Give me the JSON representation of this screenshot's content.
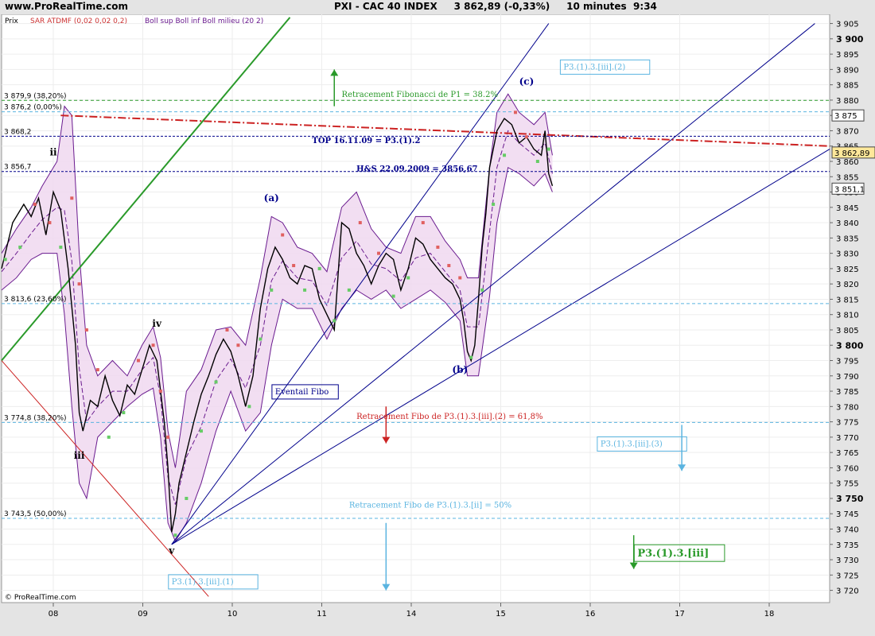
{
  "header": {
    "site": "www.ProRealTime.com",
    "title": "PXI - CAC 40 INDEX     3 862,89 (-0,33%)     10 minutes  9:34"
  },
  "legend": {
    "prix": "Prix",
    "sar": "SAR ATDMF (0,02 0,02 0,2)",
    "boll": "Boll sup Boll inf Boll milieu (20 2)"
  },
  "copyright": "© ProRealTime.com",
  "colors": {
    "price": "#000000",
    "sar_up": "#66cc66",
    "sar_down": "#e06060",
    "boll_fill": "#f0d8f0",
    "boll_line": "#6a1b8f",
    "fib_line": "#5ab4e0",
    "blue_line": "#00008b",
    "green_line": "#2a9a2a",
    "red_line": "#cc2222"
  },
  "chart_data": {
    "type": "line",
    "x_ticks": [
      "08",
      "09",
      "10",
      "11",
      "14",
      "15",
      "16",
      "17",
      "18"
    ],
    "y_ticks": [
      3720,
      3725,
      3730,
      3735,
      3740,
      3745,
      3750,
      3755,
      3760,
      3765,
      3770,
      3775,
      3780,
      3785,
      3790,
      3795,
      3800,
      3805,
      3810,
      3815,
      3820,
      3825,
      3830,
      3835,
      3840,
      3845,
      3850,
      3855,
      3860,
      3865,
      3870,
      3875,
      3880,
      3885,
      3890,
      3895,
      3900,
      3905
    ],
    "y_tick_labels": [
      "3 720",
      "3 725",
      "3 730",
      "3 735",
      "3 740",
      "3 745",
      "3 750",
      "3 755",
      "3 760",
      "3 765",
      "3 770",
      "3 775",
      "3 780",
      "3 785",
      "3 790",
      "3 795",
      "3 800",
      "3 805",
      "3 810",
      "3 815",
      "3 820",
      "3 825",
      "3 830",
      "3 835",
      "3 840",
      "3 845",
      "3 850",
      "3 855",
      "3 860",
      "3 865",
      "3 870",
      "3 875",
      "3 880",
      "3 885",
      "3 890",
      "3 895",
      "3 900",
      "3 905"
    ],
    "y_bold": [
      3750,
      3800,
      3900
    ],
    "ylim": [
      3716,
      3908
    ],
    "xlim": [
      7.5,
      18.7
    ],
    "price_path": [
      [
        7.5,
        3825
      ],
      [
        7.65,
        3840
      ],
      [
        7.8,
        3846
      ],
      [
        7.9,
        3842
      ],
      [
        8.0,
        3848
      ],
      [
        8.1,
        3836
      ],
      [
        8.2,
        3850
      ],
      [
        8.3,
        3844
      ],
      [
        8.4,
        3825
      ],
      [
        8.5,
        3800
      ],
      [
        8.55,
        3778
      ],
      [
        8.6,
        3772
      ],
      [
        8.7,
        3782
      ],
      [
        8.8,
        3780
      ],
      [
        8.9,
        3790
      ],
      [
        9.0,
        3782
      ],
      [
        9.1,
        3777
      ],
      [
        9.2,
        3787
      ],
      [
        9.3,
        3784
      ],
      [
        9.4,
        3792
      ],
      [
        9.5,
        3800
      ],
      [
        9.6,
        3795
      ],
      [
        9.7,
        3775
      ],
      [
        9.75,
        3760
      ],
      [
        9.8,
        3739
      ],
      [
        9.85,
        3745
      ],
      [
        9.9,
        3755
      ],
      [
        10.0,
        3765
      ],
      [
        10.1,
        3775
      ],
      [
        10.2,
        3784
      ],
      [
        10.3,
        3790
      ],
      [
        10.4,
        3797
      ],
      [
        10.5,
        3802
      ],
      [
        10.6,
        3798
      ],
      [
        10.7,
        3790
      ],
      [
        10.8,
        3780
      ],
      [
        10.9,
        3790
      ],
      [
        11.0,
        3812
      ],
      [
        11.1,
        3825
      ],
      [
        11.2,
        3832
      ],
      [
        11.3,
        3828
      ],
      [
        11.4,
        3822
      ],
      [
        11.5,
        3820
      ],
      [
        11.6,
        3826
      ],
      [
        11.7,
        3825
      ],
      [
        11.8,
        3815
      ],
      [
        11.9,
        3810
      ],
      [
        12.0,
        3805
      ],
      [
        12.1,
        3840
      ],
      [
        12.2,
        3838
      ],
      [
        12.3,
        3830
      ],
      [
        12.4,
        3826
      ],
      [
        12.5,
        3820
      ],
      [
        12.6,
        3826
      ],
      [
        12.7,
        3830
      ],
      [
        12.8,
        3828
      ],
      [
        12.9,
        3818
      ],
      [
        13.0,
        3825
      ],
      [
        13.1,
        3835
      ],
      [
        13.2,
        3833
      ],
      [
        13.3,
        3828
      ],
      [
        13.4,
        3825
      ],
      [
        13.5,
        3822
      ],
      [
        13.6,
        3820
      ],
      [
        13.7,
        3815
      ],
      [
        13.75,
        3808
      ],
      [
        13.8,
        3798
      ],
      [
        13.85,
        3795
      ],
      [
        13.9,
        3800
      ],
      [
        13.95,
        3815
      ],
      [
        14.0,
        3832
      ],
      [
        14.05,
        3843
      ],
      [
        14.1,
        3858
      ],
      [
        14.2,
        3870
      ],
      [
        14.3,
        3874
      ],
      [
        14.4,
        3872
      ],
      [
        14.5,
        3866
      ],
      [
        14.6,
        3868
      ],
      [
        14.7,
        3864
      ],
      [
        14.8,
        3862
      ],
      [
        14.85,
        3870
      ],
      [
        14.9,
        3856
      ],
      [
        14.95,
        3852
      ]
    ],
    "sar_path": [
      [
        7.55,
        3828,
        "up"
      ],
      [
        7.75,
        3832,
        "up"
      ],
      [
        7.95,
        3846,
        "down"
      ],
      [
        8.15,
        3840,
        "down"
      ],
      [
        8.3,
        3832,
        "up"
      ],
      [
        8.45,
        3848,
        "down"
      ],
      [
        8.55,
        3820,
        "down"
      ],
      [
        8.65,
        3805,
        "down"
      ],
      [
        8.8,
        3792,
        "down"
      ],
      [
        8.95,
        3770,
        "up"
      ],
      [
        9.15,
        3778,
        "up"
      ],
      [
        9.35,
        3795,
        "down"
      ],
      [
        9.55,
        3800,
        "down"
      ],
      [
        9.65,
        3785,
        "down"
      ],
      [
        9.75,
        3770,
        "down"
      ],
      [
        9.85,
        3738,
        "up"
      ],
      [
        10.0,
        3750,
        "up"
      ],
      [
        10.2,
        3772,
        "up"
      ],
      [
        10.4,
        3788,
        "up"
      ],
      [
        10.55,
        3805,
        "down"
      ],
      [
        10.7,
        3800,
        "down"
      ],
      [
        10.85,
        3780,
        "up"
      ],
      [
        11.0,
        3802,
        "up"
      ],
      [
        11.15,
        3818,
        "up"
      ],
      [
        11.3,
        3836,
        "down"
      ],
      [
        11.45,
        3826,
        "down"
      ],
      [
        11.6,
        3818,
        "up"
      ],
      [
        11.8,
        3825,
        "up"
      ],
      [
        12.0,
        3808,
        "up"
      ],
      [
        12.2,
        3818,
        "up"
      ],
      [
        12.35,
        3840,
        "down"
      ],
      [
        12.6,
        3830,
        "down"
      ],
      [
        12.8,
        3816,
        "up"
      ],
      [
        13.0,
        3822,
        "up"
      ],
      [
        13.2,
        3840,
        "down"
      ],
      [
        13.4,
        3832,
        "down"
      ],
      [
        13.55,
        3826,
        "down"
      ],
      [
        13.7,
        3822,
        "down"
      ],
      [
        13.85,
        3796,
        "up"
      ],
      [
        14.0,
        3818,
        "up"
      ],
      [
        14.15,
        3846,
        "up"
      ],
      [
        14.3,
        3862,
        "up"
      ],
      [
        14.45,
        3876,
        "down"
      ],
      [
        14.6,
        3868,
        "down"
      ],
      [
        14.75,
        3860,
        "up"
      ],
      [
        14.9,
        3864,
        "up"
      ]
    ],
    "boll_upper": [
      [
        7.5,
        3830
      ],
      [
        7.7,
        3838
      ],
      [
        7.9,
        3845
      ],
      [
        8.05,
        3852
      ],
      [
        8.25,
        3860
      ],
      [
        8.35,
        3878
      ],
      [
        8.45,
        3875
      ],
      [
        8.55,
        3830
      ],
      [
        8.65,
        3800
      ],
      [
        8.8,
        3790
      ],
      [
        9.0,
        3795
      ],
      [
        9.2,
        3790
      ],
      [
        9.4,
        3800
      ],
      [
        9.55,
        3806
      ],
      [
        9.65,
        3796
      ],
      [
        9.75,
        3772
      ],
      [
        9.85,
        3760
      ],
      [
        10.0,
        3785
      ],
      [
        10.2,
        3792
      ],
      [
        10.4,
        3805
      ],
      [
        10.6,
        3806
      ],
      [
        10.8,
        3800
      ],
      [
        11.0,
        3822
      ],
      [
        11.15,
        3842
      ],
      [
        11.3,
        3840
      ],
      [
        11.5,
        3832
      ],
      [
        11.7,
        3830
      ],
      [
        11.9,
        3824
      ],
      [
        12.1,
        3845
      ],
      [
        12.3,
        3850
      ],
      [
        12.5,
        3838
      ],
      [
        12.7,
        3832
      ],
      [
        12.9,
        3830
      ],
      [
        13.1,
        3842
      ],
      [
        13.3,
        3842
      ],
      [
        13.5,
        3834
      ],
      [
        13.7,
        3828
      ],
      [
        13.8,
        3822
      ],
      [
        13.95,
        3822
      ],
      [
        14.1,
        3858
      ],
      [
        14.2,
        3876
      ],
      [
        14.35,
        3882
      ],
      [
        14.5,
        3876
      ],
      [
        14.7,
        3872
      ],
      [
        14.85,
        3876
      ],
      [
        14.95,
        3862
      ]
    ],
    "boll_lower": [
      [
        7.5,
        3818
      ],
      [
        7.7,
        3822
      ],
      [
        7.9,
        3828
      ],
      [
        8.05,
        3830
      ],
      [
        8.25,
        3830
      ],
      [
        8.35,
        3810
      ],
      [
        8.45,
        3780
      ],
      [
        8.55,
        3755
      ],
      [
        8.65,
        3750
      ],
      [
        8.8,
        3770
      ],
      [
        9.0,
        3775
      ],
      [
        9.2,
        3780
      ],
      [
        9.4,
        3784
      ],
      [
        9.55,
        3786
      ],
      [
        9.65,
        3770
      ],
      [
        9.75,
        3742
      ],
      [
        9.85,
        3736
      ],
      [
        10.0,
        3742
      ],
      [
        10.2,
        3755
      ],
      [
        10.4,
        3772
      ],
      [
        10.6,
        3785
      ],
      [
        10.8,
        3772
      ],
      [
        11.0,
        3778
      ],
      [
        11.15,
        3800
      ],
      [
        11.3,
        3815
      ],
      [
        11.5,
        3812
      ],
      [
        11.7,
        3812
      ],
      [
        11.9,
        3802
      ],
      [
        12.1,
        3812
      ],
      [
        12.3,
        3818
      ],
      [
        12.5,
        3815
      ],
      [
        12.7,
        3818
      ],
      [
        12.9,
        3812
      ],
      [
        13.1,
        3815
      ],
      [
        13.3,
        3818
      ],
      [
        13.5,
        3814
      ],
      [
        13.7,
        3808
      ],
      [
        13.8,
        3790
      ],
      [
        13.95,
        3790
      ],
      [
        14.1,
        3816
      ],
      [
        14.2,
        3840
      ],
      [
        14.35,
        3858
      ],
      [
        14.5,
        3856
      ],
      [
        14.7,
        3852
      ],
      [
        14.85,
        3856
      ],
      [
        14.95,
        3850
      ]
    ],
    "hlines": [
      {
        "value": 3879.9,
        "label": "3 879,9 (38,20%)",
        "color": "#2a9a2a"
      },
      {
        "value": 3876.2,
        "label": "3 876,2 (0,00%)",
        "color": "#5ab4e0"
      },
      {
        "value": 3868.2,
        "label": "3 868,2",
        "color": "#00008b"
      },
      {
        "value": 3856.7,
        "label": "3 856,7",
        "color": "#00008b"
      },
      {
        "value": 3813.6,
        "label": "3 813,6 (23,60%)",
        "color": "#5ab4e0"
      },
      {
        "value": 3774.8,
        "label": "3 774,8 (38,20%)",
        "color": "#5ab4e0"
      },
      {
        "value": 3743.5,
        "label": "3 743,5 (50,00%)",
        "color": "#5ab4e0"
      }
    ],
    "price_tags": [
      {
        "value": 3875,
        "label": "3 875"
      },
      {
        "value": 3862.89,
        "label": "3 862,89"
      },
      {
        "value": 3851.1,
        "label": "3 851,1"
      }
    ],
    "wave_labels": [
      {
        "x": 8.2,
        "y": 3862,
        "label": "ii",
        "color": "#000000"
      },
      {
        "x": 8.55,
        "y": 3763,
        "label": "iii",
        "color": "#000000"
      },
      {
        "x": 9.6,
        "y": 3806,
        "label": "iv",
        "color": "#000000"
      },
      {
        "x": 9.8,
        "y": 3732,
        "label": "v",
        "color": "#000000"
      },
      {
        "x": 11.15,
        "y": 3847,
        "label": "(a)",
        "color": "#00008b"
      },
      {
        "x": 13.7,
        "y": 3791,
        "label": "(b)",
        "color": "#00008b"
      },
      {
        "x": 14.6,
        "y": 3885,
        "label": "(c)",
        "color": "#00008b"
      }
    ],
    "annotations": [
      {
        "x": 12.1,
        "y": 3881,
        "label": "Retracement Fibonacci de P1 = 38.2%",
        "color": "#2a9a2a",
        "box": false
      },
      {
        "x": 11.7,
        "y": 3866,
        "label": "TOP 16.11.09 = P3.(1).2",
        "color": "#00008b",
        "box": false,
        "bold": true
      },
      {
        "x": 12.3,
        "y": 3856.7,
        "label": "H&S 22.09.2009 = 3856,67",
        "color": "#00008b",
        "box": false,
        "bold": true
      },
      {
        "x": 12.3,
        "y": 3776,
        "label": "Retracement Fibo de P3.(1).3.[iii].(2) = 61,8%",
        "color": "#cc2222",
        "box": false
      },
      {
        "x": 12.2,
        "y": 3747,
        "label": "Retracement Fibo de P3.(1).3.[ii] = 50%",
        "color": "#5ab4e0",
        "box": false
      },
      {
        "x": 11.2,
        "y": 3784,
        "label": "Eventail Fibo",
        "color": "#00008b",
        "box": true
      },
      {
        "x": 15.1,
        "y": 3890,
        "label": "P3.(1).3.[iii].(2)",
        "color": "#5ab4e0",
        "box": true
      },
      {
        "x": 15.6,
        "y": 3767,
        "label": "P3.(1).3.[iii].(3)",
        "color": "#5ab4e0",
        "box": true
      },
      {
        "x": 9.8,
        "y": 3722,
        "label": "P3.(1).3.[iii].(1)",
        "color": "#5ab4e0",
        "box": true
      },
      {
        "x": 16.1,
        "y": 3731,
        "label": "P3.(1).3.[iii]",
        "color": "#2a9a2a",
        "box": true,
        "bold": true,
        "big": true
      }
    ],
    "arrows": [
      {
        "x": 12.0,
        "from": 3878,
        "to": 3890,
        "color": "#2a9a2a"
      },
      {
        "x": 12.7,
        "from": 3780,
        "to": 3768,
        "color": "#cc2222"
      },
      {
        "x": 12.7,
        "from": 3742,
        "to": 3720,
        "color": "#5ab4e0"
      },
      {
        "x": 16.7,
        "from": 3774,
        "to": 3759,
        "color": "#5ab4e0"
      },
      {
        "x": 16.05,
        "from": 3738,
        "to": 3727,
        "color": "#2a9a2a"
      }
    ]
  }
}
